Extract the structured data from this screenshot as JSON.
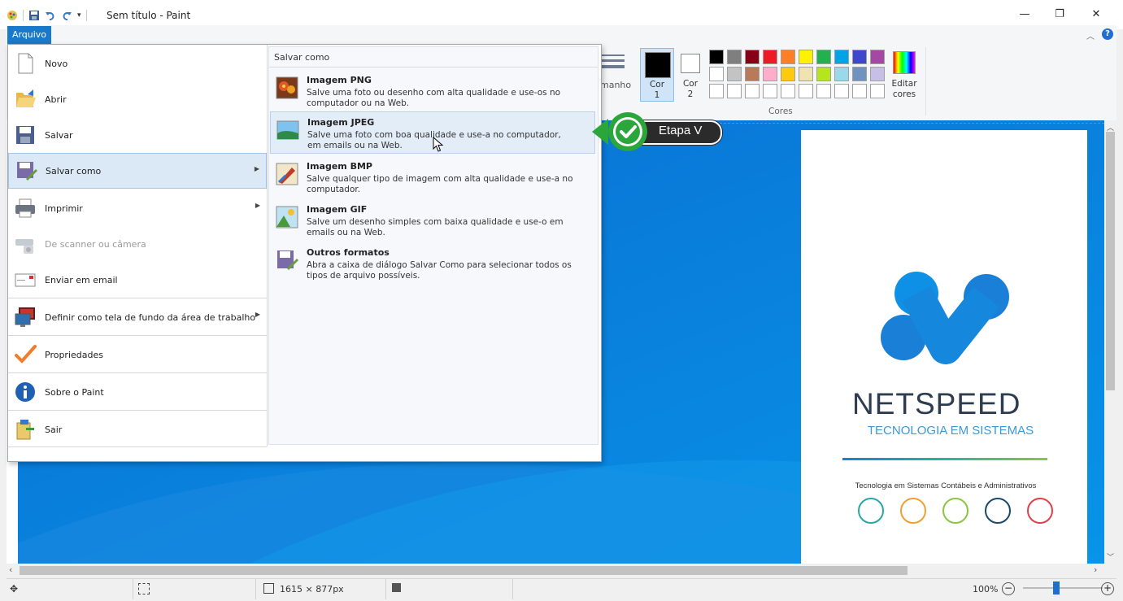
{
  "window": {
    "title": "Sem título - Paint",
    "controls": {
      "minimize": "—",
      "maximize": "❐",
      "close": "✕"
    }
  },
  "ribbon": {
    "file_tab": "Arquivo",
    "size_label": "manho",
    "color1_label": "Cor\n1",
    "color1_line1": "Cor",
    "color1_line2": "1",
    "color2_line1": "Cor",
    "color2_line2": "2",
    "edit_colors_line1": "Editar",
    "edit_colors_line2": "cores",
    "colors_group": "Cores",
    "palette": [
      [
        "#000000",
        "#7f7f7f",
        "#880015",
        "#ed1c24",
        "#ff7f27",
        "#fff200",
        "#22b14c",
        "#00a2e8",
        "#3f48cc",
        "#a349a4"
      ],
      [
        "#ffffff",
        "#c3c3c3",
        "#b97a57",
        "#ffaec9",
        "#ffc90e",
        "#efe4b0",
        "#b5e61d",
        "#99d9ea",
        "#7092be",
        "#c8bfe7"
      ],
      [
        "#ffffff",
        "#ffffff",
        "#ffffff",
        "#ffffff",
        "#ffffff",
        "#ffffff",
        "#ffffff",
        "#ffffff",
        "#ffffff",
        "#ffffff"
      ]
    ]
  },
  "file_menu": {
    "items": [
      {
        "label": "Novo",
        "icon": "new-file-icon"
      },
      {
        "label": "Abrir",
        "icon": "open-folder-icon"
      },
      {
        "label": "Salvar",
        "icon": "save-disk-icon"
      },
      {
        "label": "Salvar como",
        "icon": "save-as-icon"
      },
      {
        "label": "Imprimir",
        "icon": "printer-icon"
      },
      {
        "label": "De scanner ou câmera",
        "icon": "scanner-icon"
      },
      {
        "label": "Enviar em email",
        "icon": "email-icon"
      },
      {
        "label": "Definir como tela de fundo da área de trabalho",
        "icon": "desktop-background-icon"
      },
      {
        "label": "Propriedades",
        "icon": "checkmark-icon"
      },
      {
        "label": "Sobre o Paint",
        "icon": "info-icon"
      },
      {
        "label": "Sair",
        "icon": "exit-icon"
      }
    ],
    "submenu": {
      "title": "Salvar como",
      "items": [
        {
          "title": "Imagem PNG",
          "desc": "Salve uma foto ou desenho com alta qualidade e use-os no computador ou na Web."
        },
        {
          "title": "Imagem JPEG",
          "desc": "Salve uma foto com boa qualidade e use-a no computador, em emails ou na Web."
        },
        {
          "title": "Imagem BMP",
          "desc": "Salve qualquer tipo de imagem com alta qualidade e use-a no computador."
        },
        {
          "title": "Imagem GIF",
          "desc": "Salve um desenho simples com baixa qualidade e use-o em emails ou na Web."
        },
        {
          "title": "Outros formatos",
          "desc": "Abra a caixa de diálogo Salvar Como para selecionar todos os tipos de arquivo possíveis."
        }
      ]
    }
  },
  "callout": {
    "label": "Etapa V"
  },
  "canvas": {
    "brand": "NETSPEED",
    "tagline": "TECNOLOGIA EM SISTEMAS",
    "subtitle": "Tecnologia em Sistemas Contábeis e Administrativos"
  },
  "status": {
    "dimensions": "1615 × 877px",
    "zoom": "100%"
  }
}
